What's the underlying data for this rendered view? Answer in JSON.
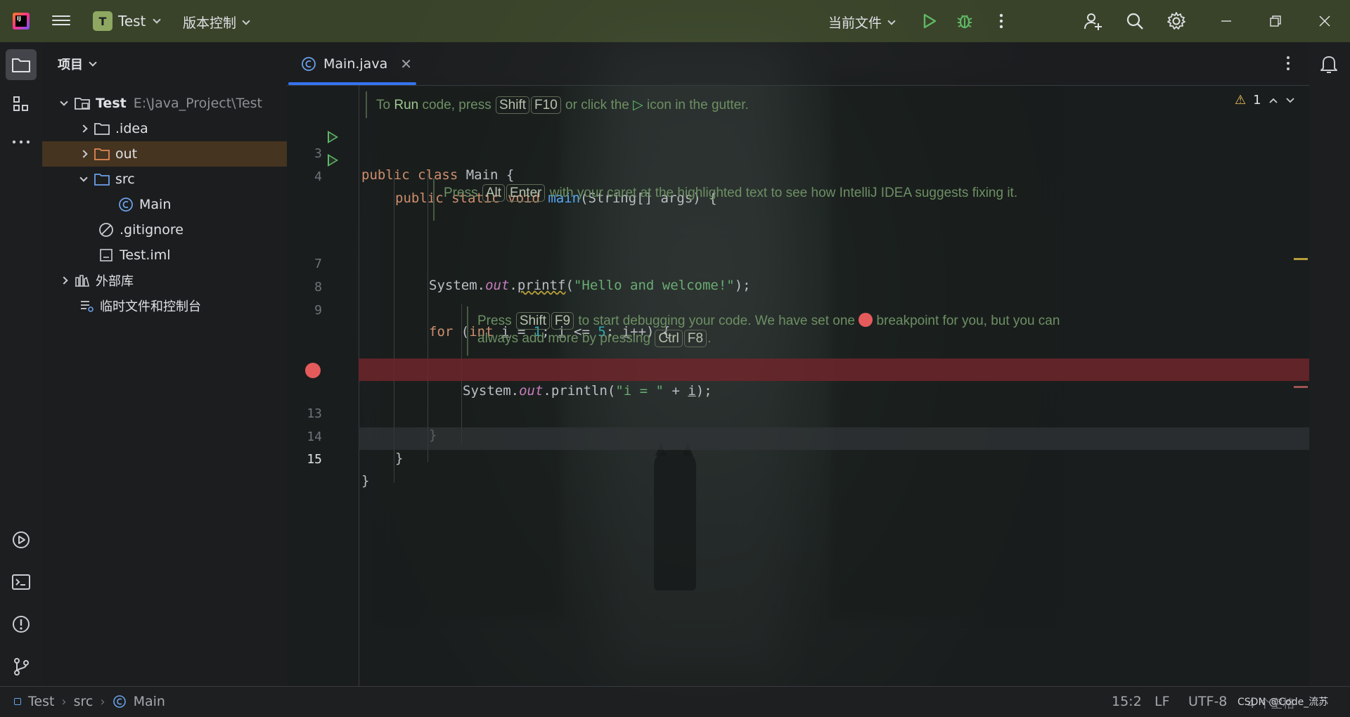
{
  "titlebar": {
    "project_badge": "T",
    "project_name": "Test",
    "vcs_label": "版本控制",
    "run_config": "当前文件"
  },
  "project_panel": {
    "title": "项目",
    "tree": [
      {
        "label": "Test",
        "path": "E:\\Java_Project\\Test"
      },
      {
        "label": ".idea"
      },
      {
        "label": "out"
      },
      {
        "label": "src"
      },
      {
        "label": "Main"
      },
      {
        "label": ".gitignore"
      },
      {
        "label": "Test.iml"
      },
      {
        "label": "外部库"
      },
      {
        "label": "临时文件和控制台"
      }
    ]
  },
  "editor": {
    "tab_label": "Main.java",
    "warning_count": "1",
    "hint1": {
      "pre": "To ",
      "run": "Run",
      "mid": " code, press ",
      "k1": "Shift",
      "k2": "F10",
      "post1": " or click the ",
      "post2": " icon in the gutter."
    },
    "hint2": {
      "pre": "Press ",
      "k1": "Alt",
      "k2": "Enter",
      "post": " with your caret at the highlighted text to see how IntelliJ IDEA suggests fixing it."
    },
    "hint3": {
      "pre": "Press ",
      "k1": "Shift",
      "k2": "F9",
      "mid": " to start debugging your code. We have set one ",
      "post": " breakpoint for you, but you can always add more by pressing ",
      "k3": "Ctrl",
      "k4": "F8",
      "end": "."
    },
    "line_numbers": {
      "l3": "3",
      "l4": "4",
      "l7": "7",
      "l8": "8",
      "l9": "9",
      "l13": "13",
      "l14": "14",
      "l15": "15"
    },
    "code": {
      "l3_kw": "public class ",
      "l3_rest": "Main {",
      "l4_kw": "public static void ",
      "l4_fn": "main",
      "l4_rest": "(String[] args) {",
      "l7_a": "System.",
      "l7_out": "out",
      "l7_dot": ".",
      "l7_fn": "printf",
      "l7_p": "(",
      "l7_str": "\"Hello and welcome!\"",
      "l7_end": ");",
      "l9_kw1": "for",
      "l9_a": " (",
      "l9_kw2": "int",
      "l9_sp": " ",
      "l9_i1": "i",
      "l9_b": " = ",
      "l9_n1": "1",
      "l9_c": "; ",
      "l9_i2": "i",
      "l9_d": " <= ",
      "l9_n2": "5",
      "l9_e": "; ",
      "l9_i3": "i",
      "l9_f": "++) {",
      "l12_a": "System.",
      "l12_out": "out",
      "l12_b": ".println(",
      "l12_str": "\"i = \"",
      "l12_c": " + ",
      "l12_i": "i",
      "l12_d": ");",
      "l13": "}",
      "l14": "}",
      "l15": "}"
    }
  },
  "statusbar": {
    "crumbs": [
      "Test",
      "src",
      "Main"
    ],
    "position": "15:2",
    "line_sep": "LF",
    "encoding": "UTF-8",
    "indent": "4 个空格"
  },
  "watermark": "CSDN @Code_流苏",
  "colors": {
    "accent": "#3574f0",
    "breakpoint": "#e55b5b",
    "run": "#5fb865",
    "titlebar": "#424e2e"
  }
}
